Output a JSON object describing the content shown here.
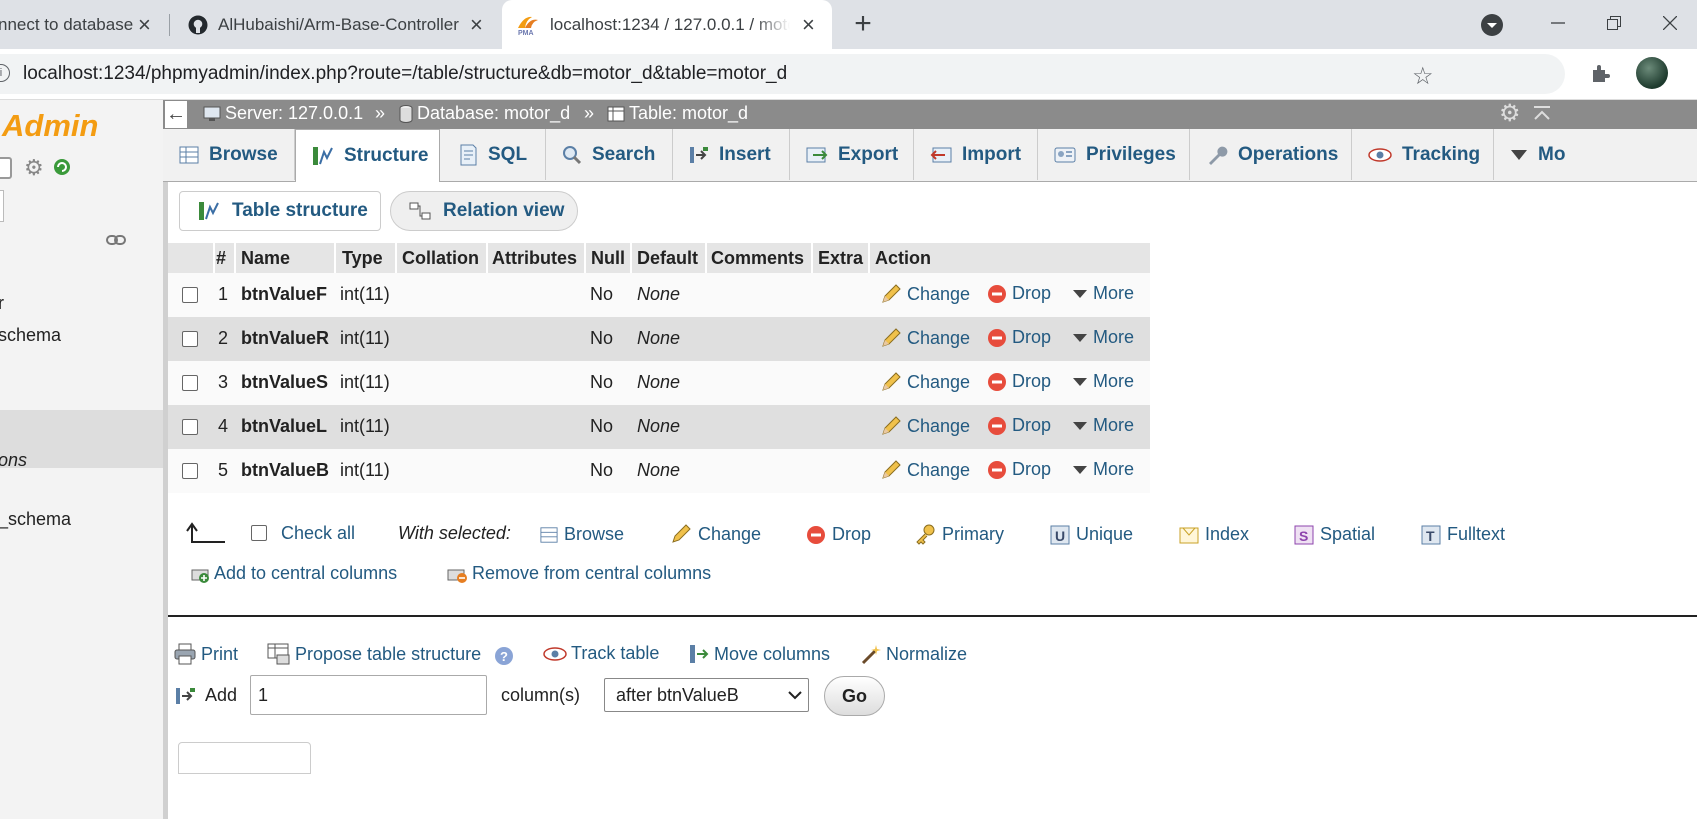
{
  "browser": {
    "tabs": [
      {
        "title": "nnect to database"
      },
      {
        "title": "AlHubaishi/Arm-Base-Controller"
      },
      {
        "title": "localhost:1234 / 127.0.0.1 / motor_d"
      }
    ],
    "address": "localhost:1234/phpmyadmin/index.php?route=/table/structure&db=motor_d&table=motor_d"
  },
  "nav": {
    "logo": "Admin",
    "items": [
      "r",
      "schema",
      "ons",
      "_schema"
    ]
  },
  "breadcrumb": {
    "server": "Server: 127.0.0.1",
    "database": "Database: motor_d",
    "table": "Table: motor_d",
    "sep": "»"
  },
  "menu": {
    "tabs": [
      "Browse",
      "Structure",
      "SQL",
      "Search",
      "Insert",
      "Export",
      "Import",
      "Privileges",
      "Operations",
      "Tracking",
      "Mo"
    ]
  },
  "subtabs": {
    "table_structure": "Table structure",
    "relation_view": "Relation view"
  },
  "table": {
    "headers": [
      "#",
      "Name",
      "Type",
      "Collation",
      "Attributes",
      "Null",
      "Default",
      "Comments",
      "Extra",
      "Action"
    ],
    "rows": [
      {
        "num": "1",
        "name": "btnValueF",
        "type": "int(11)",
        "null": "No",
        "default": "None"
      },
      {
        "num": "2",
        "name": "btnValueR",
        "type": "int(11)",
        "null": "No",
        "default": "None"
      },
      {
        "num": "3",
        "name": "btnValueS",
        "type": "int(11)",
        "null": "No",
        "default": "None"
      },
      {
        "num": "4",
        "name": "btnValueL",
        "type": "int(11)",
        "null": "No",
        "default": "None"
      },
      {
        "num": "5",
        "name": "btnValueB",
        "type": "int(11)",
        "null": "No",
        "default": "None"
      }
    ],
    "actions": {
      "change": "Change",
      "drop": "Drop",
      "more": "More"
    }
  },
  "bulk": {
    "check_all": "Check all",
    "with_selected": "With selected:",
    "browse": "Browse",
    "change": "Change",
    "drop": "Drop",
    "primary": "Primary",
    "unique": "Unique",
    "index": "Index",
    "spatial": "Spatial",
    "fulltext": "Fulltext",
    "add_central": "Add to central columns",
    "remove_central": "Remove from central columns"
  },
  "tools": {
    "print": "Print",
    "propose": "Propose table structure",
    "track": "Track table",
    "move": "Move columns",
    "normalize": "Normalize"
  },
  "add_columns": {
    "label": "Add",
    "count": "1",
    "unit": "column(s)",
    "position": "after btnValueB",
    "go": "Go"
  },
  "colors": {
    "link": "#235a81",
    "logo": "#f39c12",
    "breadcrumb": "#8b8b8b"
  }
}
